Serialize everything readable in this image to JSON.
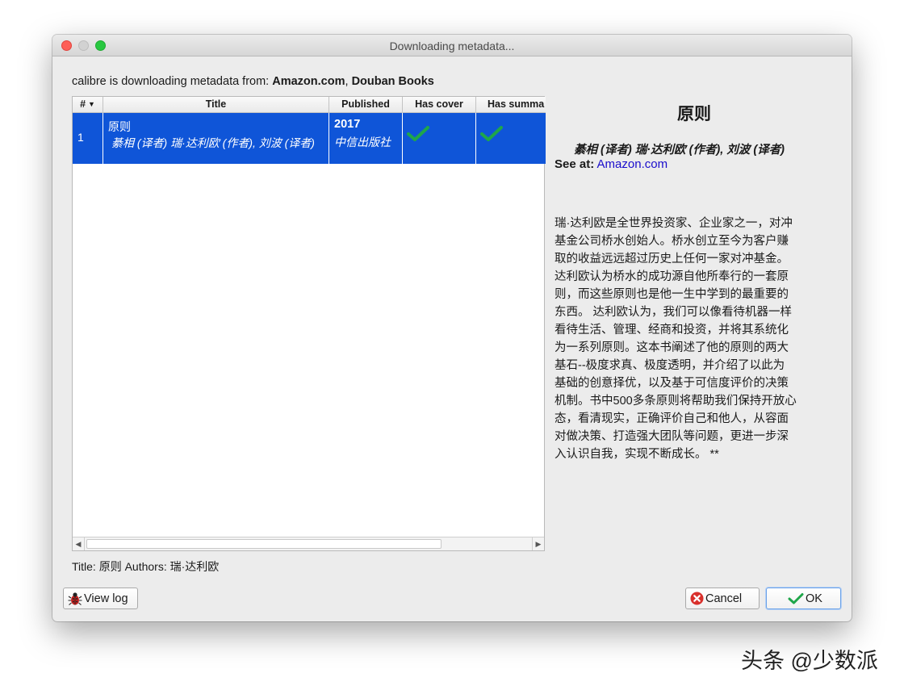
{
  "window": {
    "title": "Downloading metadata..."
  },
  "source": {
    "prefix": "calibre is downloading metadata from: ",
    "source1": "Amazon.com",
    "sep": ", ",
    "source2": "Douban Books"
  },
  "table": {
    "headers": {
      "num": "#",
      "title": "Title",
      "published": "Published",
      "cover": "Has cover",
      "summary": "Has summa"
    },
    "rows": [
      {
        "num": "1",
        "title": "原则",
        "authors": "綦相 (译者) 瑞·达利欧 (作者), 刘波 (译者)",
        "year": "2017",
        "publisher": "中信出版社",
        "has_cover": true,
        "has_summary": true
      }
    ]
  },
  "status": "Title: 原则 Authors: 瑞·达利欧",
  "details": {
    "title": "原则",
    "authors": "綦相 (译者) 瑞·达利欧 (作者), 刘波 (译者)",
    "see_at_label": "See at:",
    "see_at_link": "Amazon.com",
    "summary": "瑞·达利欧是全世界投资家、企业家之一，对冲\n基金公司桥水创始人。桥水创立至今为客户赚\n取的收益远远超过历史上任何一家对冲基金。\n达利欧认为桥水的成功源自他所奉行的一套原\n则，而这些原则也是他一生中学到的最重要的\n东西。 达利欧认为，我们可以像看待机器一样\n看待生活、管理、经商和投资，并将其系统化\n为一系列原则。这本书阐述了他的原则的两大\n基石--极度求真、极度透明，并介绍了以此为\n基础的创意择优，以及基于可信度评价的决策\n机制。书中500多条原则将帮助我们保持开放心\n态，看清现实，正确评价自己和他人，从容面\n对做决策、打造强大团队等问题，更进一步深\n入认识自我，实现不断成长。 **"
  },
  "buttons": {
    "view_log": "View log",
    "cancel": "Cancel",
    "ok": "OK"
  },
  "watermark": "头条 @少数派",
  "colors": {
    "selection": "#0f55d8",
    "check": "#1fa64a",
    "cancel_icon": "#d9302c",
    "link": "#1a0dcc"
  }
}
